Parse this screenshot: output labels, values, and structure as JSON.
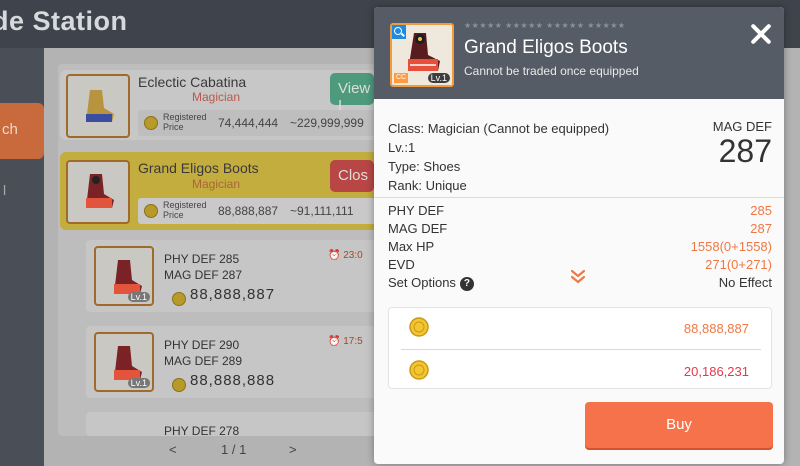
{
  "window": {
    "title": "de Station"
  },
  "sidebar": {
    "active_tab_label": "ch",
    "secondary_mark": "l"
  },
  "listings": [
    {
      "name": "Eclectic Cabatina",
      "class": "Magician",
      "price_label": "Registered Price",
      "price": "74,444,444",
      "range": "~229,999,999",
      "button": "View I"
    },
    {
      "name": "Grand Eligos Boots",
      "class": "Magician",
      "price_label": "Registered Price",
      "price": "88,888,887",
      "range": "~91,111,111",
      "button": "Clos"
    }
  ],
  "sub_listings": [
    {
      "line1": "PHY DEF 285",
      "line2": "MAG DEF 287",
      "price": "88,888,887",
      "time": "23:0",
      "level": "Lv.1"
    },
    {
      "line1": "PHY DEF 290",
      "line2": "MAG DEF 289",
      "price": "88,888,888",
      "time": "17:5",
      "level": "Lv.1"
    },
    {
      "line1": "PHY DEF 278",
      "line2": "",
      "price": "",
      "time": ""
    }
  ],
  "pager": {
    "prev": "<",
    "text": "1 / 1",
    "next": ">"
  },
  "popup": {
    "item_name": "Grand Eligos Boots",
    "trade_note": "Cannot be traded once equipped",
    "level_badge": "Lv.1",
    "cc_badge": "CC",
    "stars": "★★★★★ ★★★★★ ★★★★★ ★★★★★",
    "info": {
      "class": "Class: Magician (Cannot be equipped)",
      "level": "Lv.:1",
      "type": "Type: Shoes",
      "rank": "Rank: Unique"
    },
    "headline_stat": {
      "label": "MAG DEF",
      "value": "287"
    },
    "stats": [
      {
        "key": "PHY DEF",
        "value": "285"
      },
      {
        "key": "MAG DEF",
        "value": "287"
      },
      {
        "key": "Max HP",
        "value": "1558(0+1558)"
      },
      {
        "key": "EVD",
        "value": "271(0+271)"
      }
    ],
    "set_options": {
      "key": "Set Options",
      "value": "No Effect",
      "help": "?"
    },
    "price_primary": "88,888,887",
    "price_secondary": "20,186,231",
    "buy_label": "Buy"
  },
  "colors": {
    "accent_orange": "#f5724a",
    "stat_orange": "#f07844",
    "price_red": "#e23b4b",
    "header_gray": "#555c66"
  },
  "icons": [
    "search-icon",
    "close-icon",
    "gold-coin-icon",
    "chevron-down-icon",
    "help-icon",
    "boots-icon",
    "clock-icon"
  ]
}
